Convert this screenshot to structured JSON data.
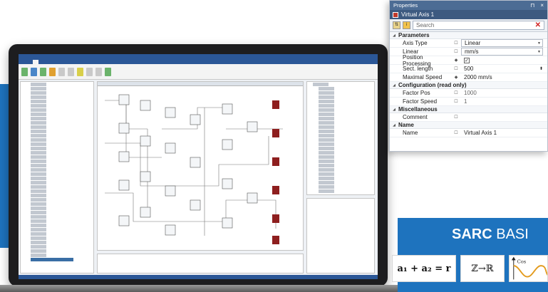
{
  "properties": {
    "title": "Properties",
    "object_name": "Virtual Axis 1",
    "search_placeholder": "Search",
    "categories": {
      "parameters": "Parameters",
      "configuration": "Configuration (read only)",
      "miscellaneous": "Miscellaneous",
      "name": "Name"
    },
    "rows": {
      "axis_type": {
        "label": "Axis Type",
        "value": "Linear"
      },
      "linear": {
        "label": "Linear",
        "value": "mm/s"
      },
      "position_processing": {
        "label": "Position Processing",
        "value": "✓"
      },
      "sect_length": {
        "label": "Sect. length",
        "value": "500"
      },
      "maximal_speed": {
        "label": "Maximal Speed",
        "value": "2000 mm/s"
      },
      "factor_pos": {
        "label": "Factor Pos",
        "value": "1000"
      },
      "factor_speed": {
        "label": "Factor Speed",
        "value": "1"
      },
      "comment": {
        "label": "Comment",
        "value": ""
      },
      "name": {
        "label": "Name",
        "value": "Virtual Axis 1"
      }
    }
  },
  "sarc": {
    "title_bold": "SARC",
    "title_rest": " BASI",
    "formula1": "a₁ + a₂ = r",
    "formula2": "ℤ→ℝ",
    "formula3": "Cos"
  },
  "colors": {
    "brand_blue": "#1e73be",
    "panel_header": "#4c6c94",
    "close_red": "#d02020"
  },
  "icons": [
    "sort-icon",
    "info-icon",
    "close-icon",
    "property-icon",
    "dropdown-chevron-icon",
    "diamond-icon",
    "spin-icon",
    "object-icon",
    "cos-wave-icon"
  ]
}
